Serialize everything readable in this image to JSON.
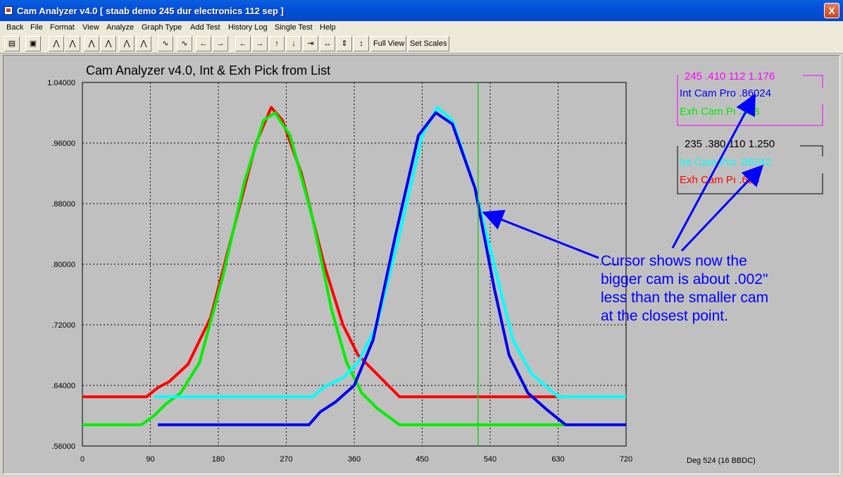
{
  "window": {
    "title": "Cam Analyzer v4.0  [ staab demo 245 dur electronics 112 sep ]",
    "close_label": "X"
  },
  "menu": [
    "Back",
    "File",
    "Format",
    "View",
    "Analyze",
    "Graph Type",
    "Add Test",
    "History Log",
    "Single Test",
    "Help"
  ],
  "toolbar": {
    "full_view": "Full View",
    "set_scales": "Set Scales"
  },
  "colors": {
    "red": "#ff0000",
    "green": "#00ee00",
    "cyan": "#00ffff",
    "blue": "#0000ee",
    "magenta": "#ff00ff",
    "cursor": "#22cc22"
  },
  "legend1": {
    "header": "245 .410 112 1.176",
    "int": "Int Cam Pro  .86024",
    "exh": "Exh Cam Pı .588"
  },
  "legend2": {
    "header": "235 .380 110 1.250",
    "int": "Int Cam Pro  .86242",
    "exh": "Exh Cam Pı .625"
  },
  "annotation": {
    "lines": [
      "Cursor shows now the",
      "bigger cam is about .002\"",
      "less than the smaller cam",
      "at the closest point."
    ]
  },
  "readout": "Deg   524 (16 BBDC)",
  "chart_data": {
    "type": "line",
    "title": "Cam Analyzer v4.0,   Int & Exh Pick from List",
    "xlabel": "",
    "ylabel": "",
    "xlim": [
      0,
      720
    ],
    "ylim": [
      0.56,
      1.04
    ],
    "x_ticks": [
      "0",
      "90",
      "180",
      "270",
      "360",
      "450",
      "540",
      "630",
      "720"
    ],
    "y_ticks": [
      ".56000",
      ".64000",
      ".72000",
      ".80000",
      ".88000",
      ".96000",
      "1.04000"
    ],
    "grid": true,
    "cursor_x": 524,
    "series": [
      {
        "color": "#ff0000",
        "x": [
          0,
          85,
          100,
          115,
          140,
          170,
          200,
          230,
          250,
          265,
          290,
          320,
          345,
          365,
          390,
          420,
          640
        ],
        "y": [
          0.625,
          0.625,
          0.637,
          0.645,
          0.668,
          0.73,
          0.845,
          0.96,
          1.007,
          0.99,
          0.92,
          0.8,
          0.72,
          0.68,
          0.655,
          0.625,
          0.625
        ]
      },
      {
        "color": "#00ee00",
        "x": [
          0,
          78,
          95,
          110,
          130,
          155,
          185,
          215,
          240,
          255,
          275,
          305,
          330,
          350,
          370,
          390,
          420,
          645
        ],
        "y": [
          0.588,
          0.588,
          0.6,
          0.615,
          0.63,
          0.67,
          0.78,
          0.91,
          0.99,
          1.0,
          0.97,
          0.86,
          0.74,
          0.67,
          0.63,
          0.61,
          0.588,
          0.588
        ]
      },
      {
        "color": "#00ffff",
        "x": [
          95,
          305,
          320,
          345,
          365,
          390,
          420,
          450,
          470,
          490,
          520,
          545,
          570,
          595,
          630,
          720
        ],
        "y": [
          0.625,
          0.625,
          0.638,
          0.65,
          0.67,
          0.72,
          0.84,
          0.97,
          1.007,
          0.99,
          0.9,
          0.8,
          0.7,
          0.655,
          0.625,
          0.625
        ]
      },
      {
        "color": "#0000ee",
        "x": [
          100,
          300,
          315,
          335,
          360,
          385,
          415,
          445,
          468,
          490,
          520,
          545,
          565,
          590,
          615,
          640,
          720
        ],
        "y": [
          0.588,
          0.588,
          0.605,
          0.618,
          0.64,
          0.7,
          0.84,
          0.97,
          1.0,
          0.985,
          0.9,
          0.77,
          0.68,
          0.63,
          0.608,
          0.588,
          0.588
        ]
      }
    ]
  }
}
